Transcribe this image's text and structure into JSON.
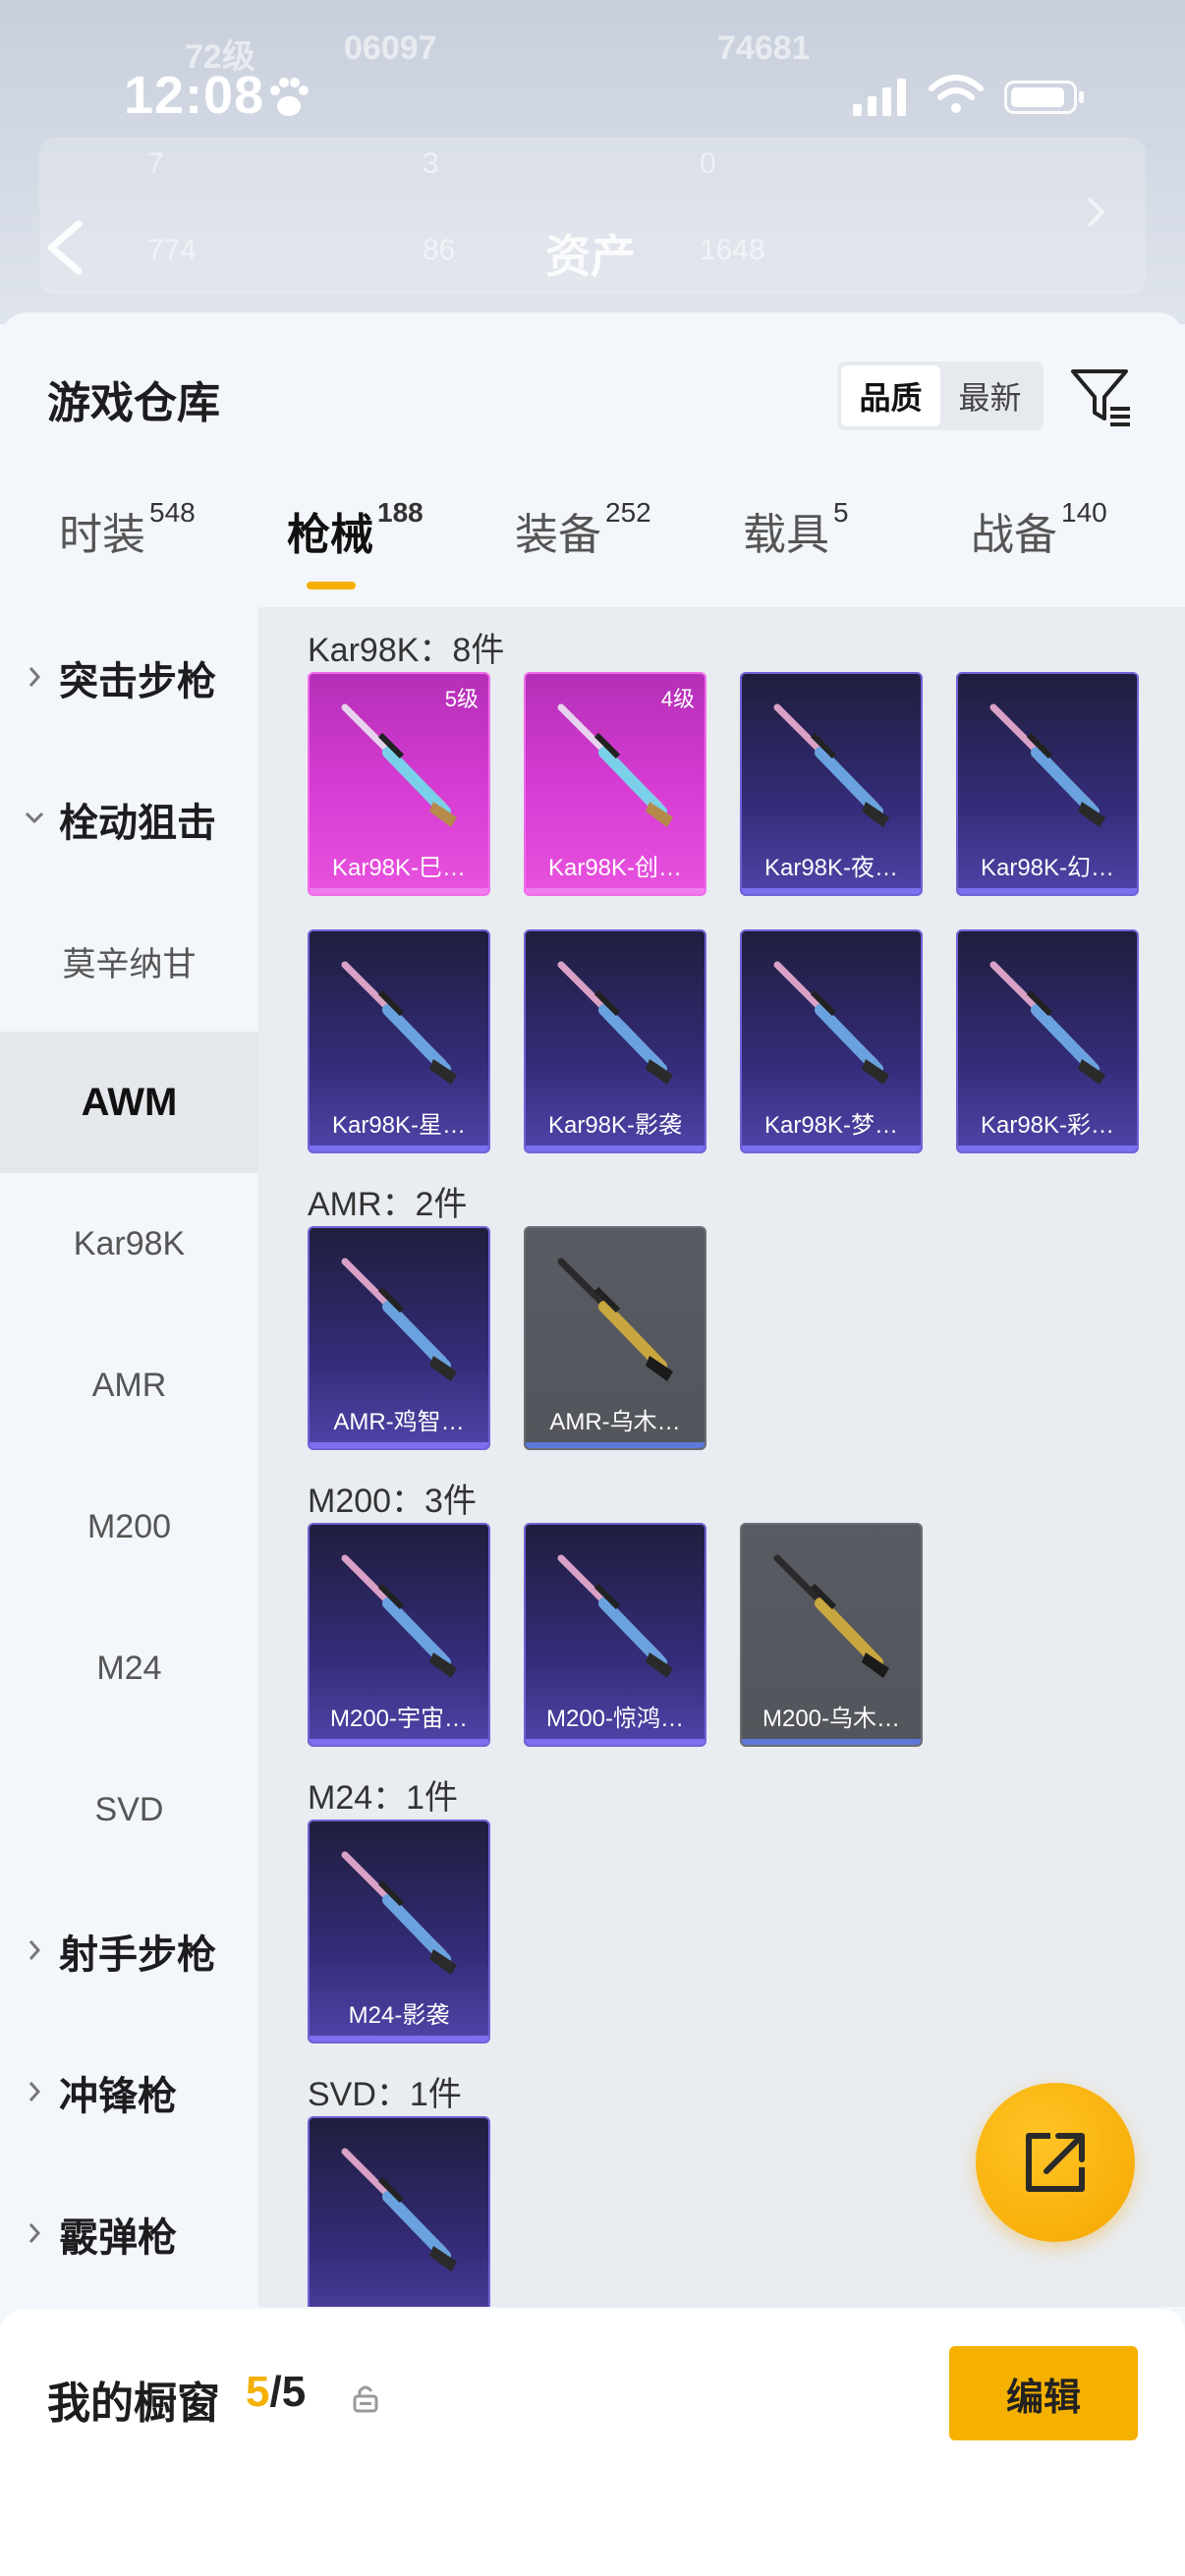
{
  "backdrop": {
    "level_text": "72级",
    "coins_text": "06097",
    "friends_text": "74681",
    "stats": [
      "7",
      "3",
      "0",
      "774",
      "86",
      "1648"
    ],
    "title": "资产"
  },
  "status_bar": {
    "time": "12:08"
  },
  "sheet": {
    "title": "游戏仓库",
    "sort_options": [
      "品质",
      "最新"
    ],
    "sort_selected": "品质"
  },
  "tabs": [
    {
      "label": "时装",
      "count": "548"
    },
    {
      "label": "枪械",
      "count": "188"
    },
    {
      "label": "装备",
      "count": "252"
    },
    {
      "label": "载具",
      "count": "5"
    },
    {
      "label": "战备",
      "count": "140"
    }
  ],
  "sidebar": [
    {
      "label": "突击步枪",
      "kind": "group",
      "expanded": false
    },
    {
      "label": "栓动狙击",
      "kind": "group",
      "expanded": true
    },
    {
      "label": "莫辛纳甘",
      "kind": "sub"
    },
    {
      "label": "AWM",
      "kind": "sub",
      "selected": true
    },
    {
      "label": "Kar98K",
      "kind": "sub"
    },
    {
      "label": "AMR",
      "kind": "sub"
    },
    {
      "label": "M200",
      "kind": "sub"
    },
    {
      "label": "M24",
      "kind": "sub"
    },
    {
      "label": "SVD",
      "kind": "sub"
    },
    {
      "label": "射手步枪",
      "kind": "group",
      "expanded": false
    },
    {
      "label": "冲锋枪",
      "kind": "group",
      "expanded": false
    },
    {
      "label": "霰弹枪",
      "kind": "group",
      "expanded": false
    }
  ],
  "sections": [
    {
      "header": "Kar98K：8件",
      "items": [
        {
          "label": "Kar98K-巳…",
          "rarity": "pink",
          "level": "5级"
        },
        {
          "label": "Kar98K-创…",
          "rarity": "pink",
          "level": "4级"
        },
        {
          "label": "Kar98K-夜…",
          "rarity": "purple"
        },
        {
          "label": "Kar98K-幻…",
          "rarity": "purple"
        },
        {
          "label": "Kar98K-星…",
          "rarity": "purple"
        },
        {
          "label": "Kar98K-影袭",
          "rarity": "purple"
        },
        {
          "label": "Kar98K-梦…",
          "rarity": "purple"
        },
        {
          "label": "Kar98K-彩…",
          "rarity": "purple"
        }
      ]
    },
    {
      "header": "AMR：2件",
      "items": [
        {
          "label": "AMR-鸡智…",
          "rarity": "purple"
        },
        {
          "label": "AMR-乌木…",
          "rarity": "gray"
        }
      ]
    },
    {
      "header": "M200：3件",
      "items": [
        {
          "label": "M200-宇宙…",
          "rarity": "purple"
        },
        {
          "label": "M200-惊鸿…",
          "rarity": "purple"
        },
        {
          "label": "M200-乌木…",
          "rarity": "gray"
        }
      ]
    },
    {
      "header": "M24：1件",
      "items": [
        {
          "label": "M24-影袭",
          "rarity": "purple"
        }
      ]
    },
    {
      "header": "SVD：1件",
      "items": [
        {
          "label": "",
          "rarity": "purple"
        }
      ]
    }
  ],
  "showcase": {
    "title": "我的橱窗",
    "current": "5",
    "separator": "/",
    "total": "5",
    "edit_label": "编辑"
  },
  "colors": {
    "accent": "#f5b000",
    "rarity_pink": "#d83dd4",
    "rarity_purple": "#342c79",
    "rarity_gray": "#595b63"
  }
}
